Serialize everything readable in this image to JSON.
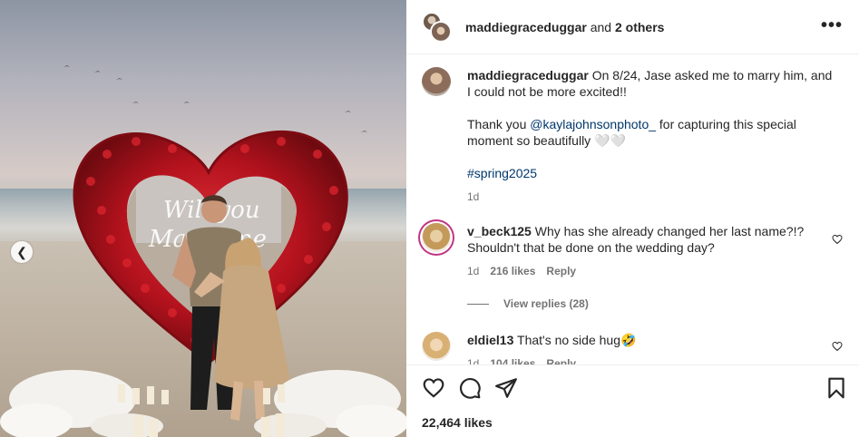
{
  "header": {
    "username": "maddiegraceduggar",
    "others_text": " and ",
    "others_count": "2 others",
    "more_label": "•••"
  },
  "caption": {
    "username": "maddiegraceduggar",
    "text_line1": " On 8/24, Jase asked me to marry him, and I could not be more excited!!",
    "thanks_prefix": "Thank you ",
    "mention": "@kaylajohnsonphoto_",
    "thanks_suffix": " for capturing this special moment so beautifully 🤍🤍",
    "hashtag": "#spring2025",
    "time": "1d"
  },
  "comments": [
    {
      "username": "v_beck125",
      "text": " Why has she already changed her last name?!? Shouldn't that be done on the wedding day?",
      "time": "1d",
      "likes": "216 likes",
      "reply": "Reply",
      "view_replies": "View replies (28)"
    },
    {
      "username": "eldiel13",
      "text": " That's no side hug🤣",
      "time": "1d",
      "likes": "104 likes",
      "reply": "Reply"
    }
  ],
  "actions": {
    "likes_count": "22,464 likes"
  },
  "photo": {
    "neon_line1": "Will you",
    "neon_line2": "Marry me"
  },
  "icons": {
    "prev": "chevron-left-icon",
    "like": "heart-icon",
    "comment": "comment-icon",
    "share": "send-icon",
    "save": "bookmark-icon",
    "comment_like": "heart-icon",
    "more": "more-horizontal-icon"
  },
  "colors": {
    "link": "#00376b",
    "muted": "#737373",
    "rose": "#b3121d"
  }
}
